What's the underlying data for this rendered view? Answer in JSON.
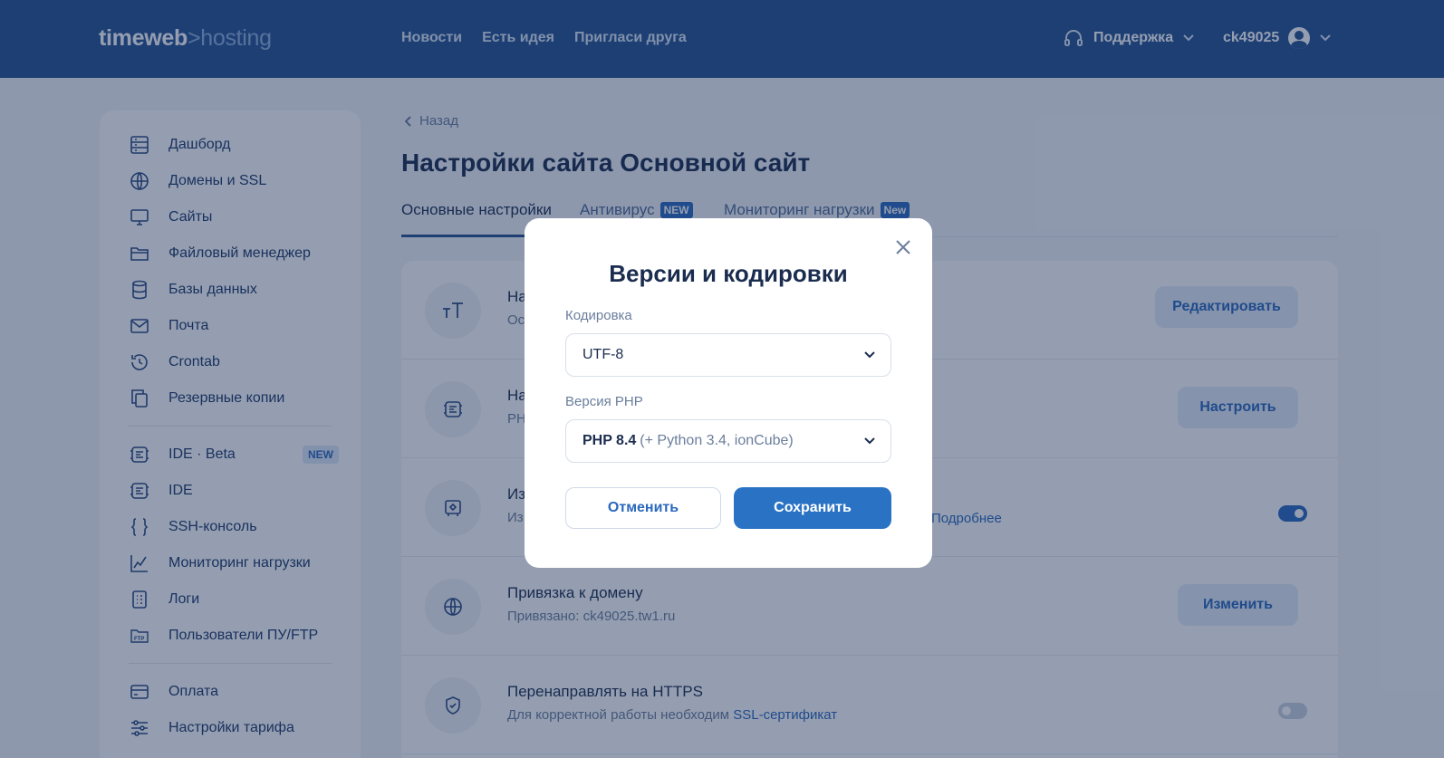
{
  "header": {
    "logo_main": "timeweb",
    "logo_sep": ">",
    "logo_sub": "hosting",
    "nav": [
      "Новости",
      "Есть идея",
      "Пригласи друга"
    ],
    "support_label": "Поддержка",
    "username": "ck49025"
  },
  "sidebar": {
    "items": [
      {
        "label": "Дашборд",
        "icon": "dashboard-icon"
      },
      {
        "label": "Домены и SSL",
        "icon": "globe-icon"
      },
      {
        "label": "Сайты",
        "icon": "monitor-icon"
      },
      {
        "label": "Файловый менеджер",
        "icon": "folder-icon"
      },
      {
        "label": "Базы данных",
        "icon": "database-icon"
      },
      {
        "label": "Почта",
        "icon": "mail-icon"
      },
      {
        "label": "Crontab",
        "icon": "history-icon"
      },
      {
        "label": "Резервные копии",
        "icon": "copy-icon"
      },
      {
        "label": "IDE · Beta",
        "icon": "ide-icon",
        "badge": "NEW"
      },
      {
        "label": "IDE",
        "icon": "ide-icon"
      },
      {
        "label": "SSH-консоль",
        "icon": "braces-icon"
      },
      {
        "label": "Мониторинг нагрузки",
        "icon": "chart-icon"
      },
      {
        "label": "Логи",
        "icon": "log-icon"
      },
      {
        "label": "Пользователи ПУ/FTP",
        "icon": "ftp-icon"
      },
      {
        "label": "Оплата",
        "icon": "card-icon"
      },
      {
        "label": "Настройки тарифа",
        "icon": "sliders-icon"
      }
    ]
  },
  "main": {
    "back_label": "Назад",
    "title": "Настройки сайта Основной сайт",
    "tabs": [
      {
        "label": "Основные настройки",
        "active": true
      },
      {
        "label": "Антивирус",
        "badge": "NEW"
      },
      {
        "label": "Мониторинг нагрузки",
        "badge": "New"
      }
    ],
    "rows": [
      {
        "title": "На",
        "sub": "Ос",
        "button": "Редактировать"
      },
      {
        "title": "На",
        "sub": "PH",
        "button": "Настроить"
      },
      {
        "title": "Из",
        "sub": "Из",
        "toggle": true,
        "link": "Подробнее"
      },
      {
        "title": "Привязка к домену",
        "sub": "Привязано: ck49025.tw1.ru",
        "button": "Изменить"
      },
      {
        "title": "Перенаправлять на HTTPS",
        "sub": "Для корректной работы необходим",
        "sub_link": "SSL-сертификат",
        "toggle": false
      }
    ]
  },
  "modal": {
    "title": "Версии и кодировки",
    "encoding_label": "Кодировка",
    "encoding_value": "UTF-8",
    "php_label": "Версия PHP",
    "php_value": "PHP 8.4",
    "php_extra": "(+ Python 3.4, ionCube)",
    "cancel_label": "Отменить",
    "save_label": "Сохранить"
  },
  "colors": {
    "header_bg": "#255393",
    "accent": "#2a73c4",
    "overlay": "rgba(20,40,80,0.45)"
  }
}
